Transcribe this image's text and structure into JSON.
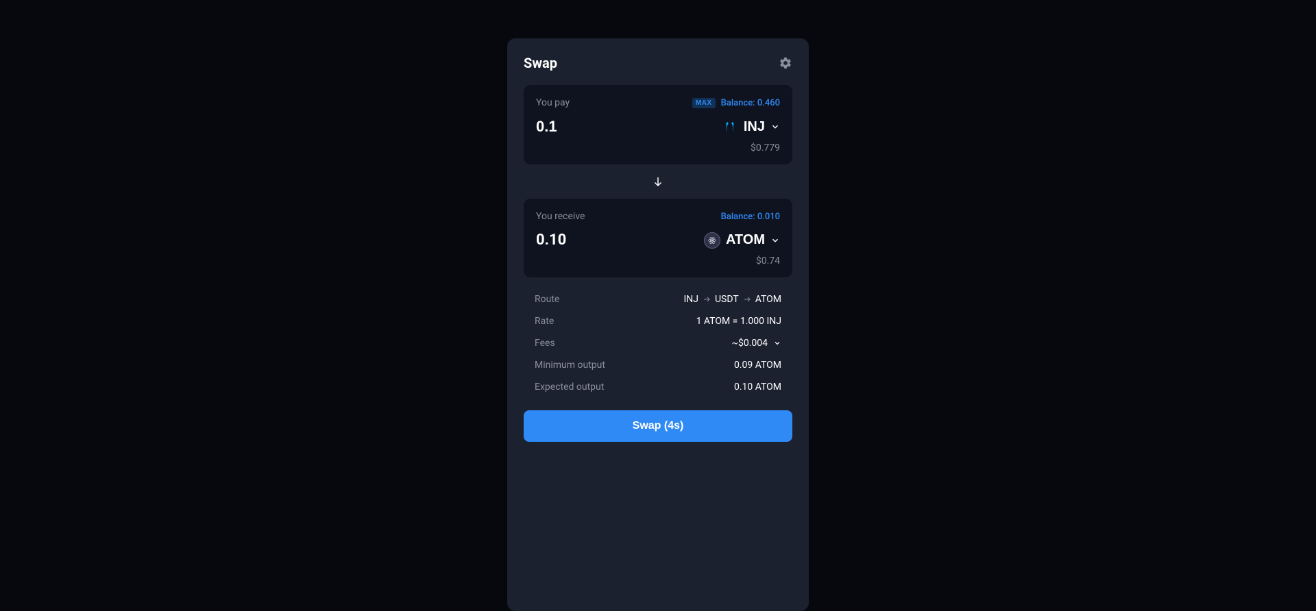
{
  "header": {
    "title": "Swap"
  },
  "pay": {
    "label": "You pay",
    "max_label": "MAX",
    "balance_label": "Balance: 0.460",
    "amount": "0.1",
    "token_symbol": "INJ",
    "usd_value": "$0.779"
  },
  "receive": {
    "label": "You receive",
    "balance_label": "Balance: 0.010",
    "amount": "0.10",
    "token_symbol": "ATOM",
    "usd_value": "$0.74"
  },
  "details": {
    "route_label": "Route",
    "route_segments": [
      "INJ",
      "USDT",
      "ATOM"
    ],
    "rate_label": "Rate",
    "rate_value": "1 ATOM = 1.000 INJ",
    "fees_label": "Fees",
    "fees_value": "~$0.004",
    "min_output_label": "Minimum output",
    "min_output_value": "0.09 ATOM",
    "expected_output_label": "Expected output",
    "expected_output_value": "0.10 ATOM"
  },
  "action": {
    "swap_button_label": "Swap (4s)"
  }
}
